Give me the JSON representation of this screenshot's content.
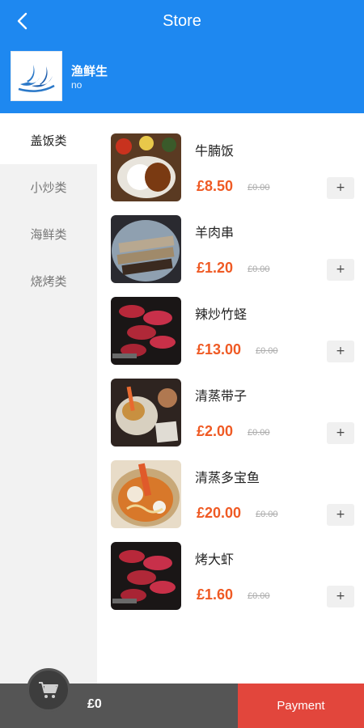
{
  "header": {
    "title": "Store",
    "back_icon": "chevron-left-icon",
    "bg_color": "#1e88f0"
  },
  "store": {
    "name": "渔鲜生",
    "subtitle": "no",
    "logo_icon": "wave-logo"
  },
  "categories": [
    {
      "label": "盖饭类",
      "active": true
    },
    {
      "label": "小炒类",
      "active": false
    },
    {
      "label": "海鲜类",
      "active": false
    },
    {
      "label": "烧烤类",
      "active": false
    }
  ],
  "items": [
    {
      "name": "牛腩饭",
      "price": "£8.50",
      "original_price": "£0.00",
      "add_label": "+",
      "image": "curry-rice-photo"
    },
    {
      "name": "羊肉串",
      "price": "£1.20",
      "original_price": "£0.00",
      "add_label": "+",
      "image": "skewers-photo"
    },
    {
      "name": "辣炒竹蛏",
      "price": "£13.00",
      "original_price": "£0.00",
      "add_label": "+",
      "image": "raw-meat-photo"
    },
    {
      "name": "清蒸带子",
      "price": "£2.00",
      "original_price": "£0.00",
      "add_label": "+",
      "image": "fried-shrimp-photo"
    },
    {
      "name": "清蒸多宝鱼",
      "price": "£20.00",
      "original_price": "£0.00",
      "add_label": "+",
      "image": "ramen-photo"
    },
    {
      "name": "烤大虾",
      "price": "£1.60",
      "original_price": "£0.00",
      "add_label": "+",
      "image": "raw-meat-photo"
    }
  ],
  "footer": {
    "total": "£0",
    "payment_label": "Payment",
    "cart_icon": "cart-icon",
    "payment_color": "#e2463c"
  }
}
